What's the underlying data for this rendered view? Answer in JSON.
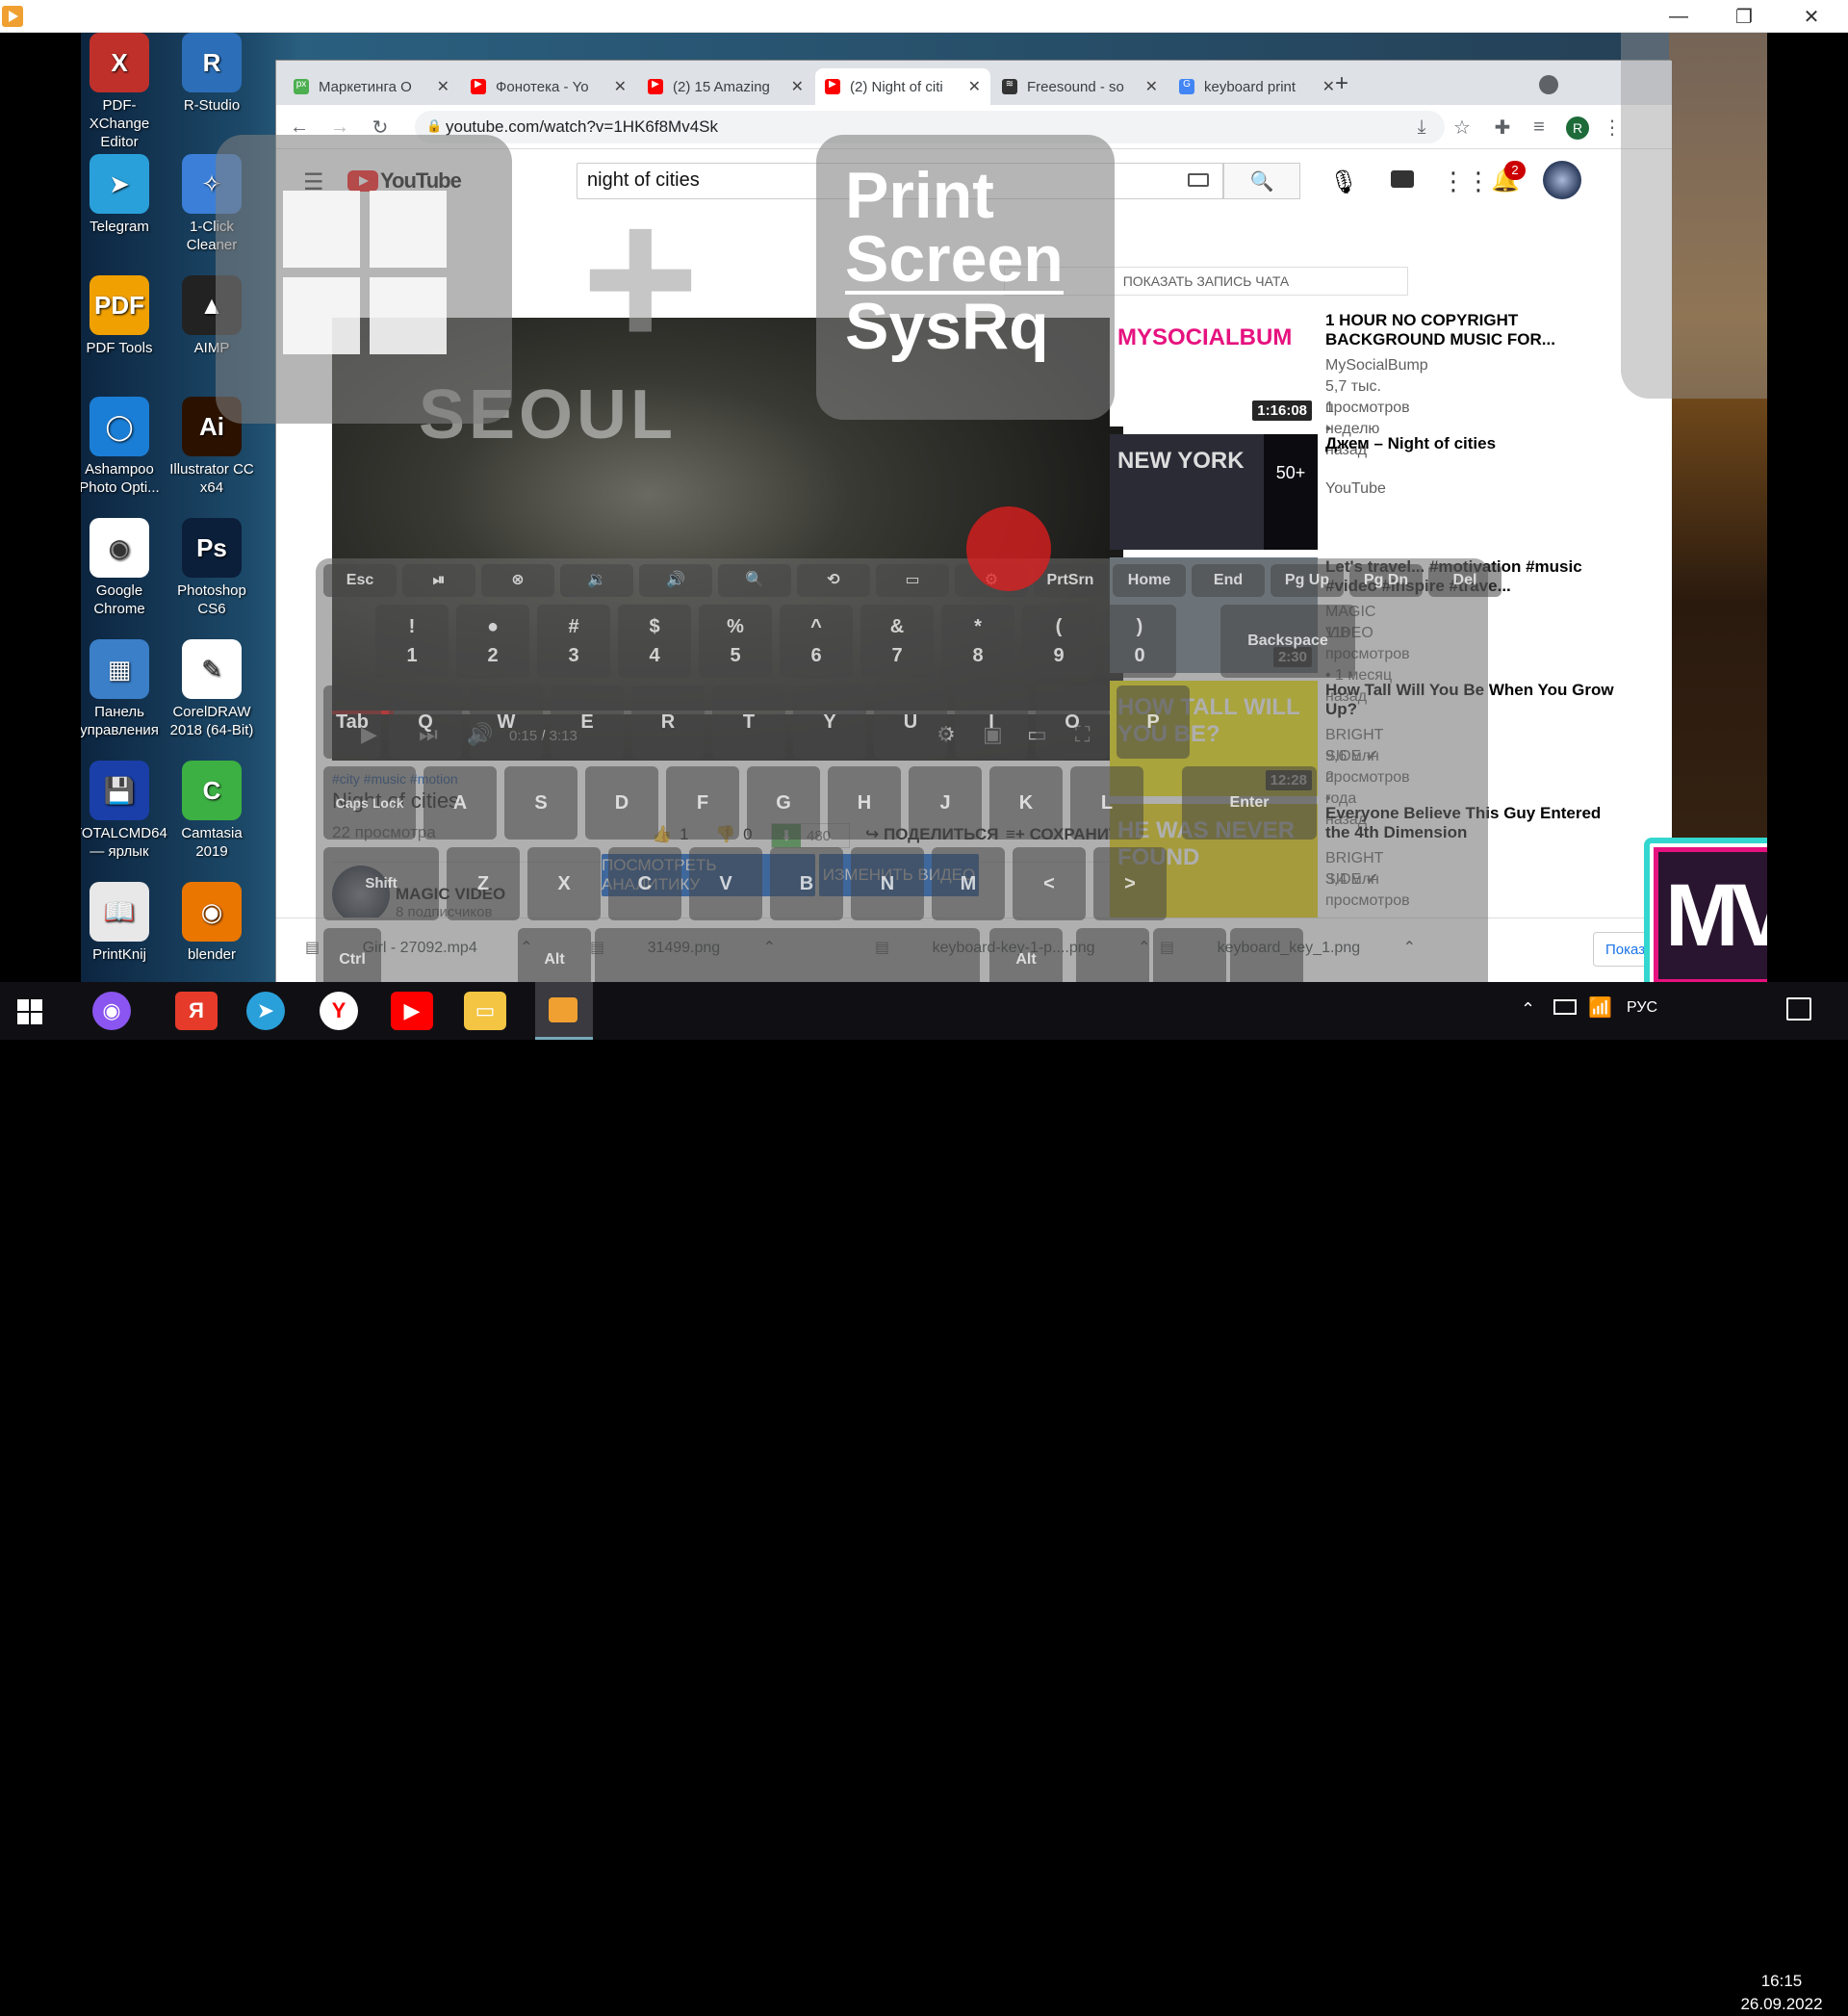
{
  "window": {
    "min": "—",
    "restore": "❐",
    "close": "✕"
  },
  "desktop": {
    "icons": [
      {
        "label": "PDF-XChange Editor",
        "color": "#c0302a",
        "glyph": "X"
      },
      {
        "label": "R-Studio",
        "color": "#2c6fb8",
        "glyph": "R"
      },
      {
        "label": "Telegram",
        "color": "#2aa0da",
        "glyph": "➤"
      },
      {
        "label": "1-Click Cleaner",
        "color": "#3b7fd8",
        "glyph": "✧"
      },
      {
        "label": "PDF Tools",
        "color": "#f0a000",
        "glyph": "PDF"
      },
      {
        "label": "AIMP",
        "color": "#222",
        "glyph": "▲"
      },
      {
        "label": "Ashampoo Photo Opti...",
        "color": "#1b7ed6",
        "glyph": "◯"
      },
      {
        "label": "Illustrator CC x64",
        "color": "#2b1200",
        "glyph": "Ai"
      },
      {
        "label": "Google Chrome",
        "color": "#fff",
        "glyph": "◉"
      },
      {
        "label": "Photoshop CS6",
        "color": "#0b1e3a",
        "glyph": "Ps"
      },
      {
        "label": "Панель управления",
        "color": "#3a7fc8",
        "glyph": "▦"
      },
      {
        "label": "CorelDRAW 2018 (64-Bit)",
        "color": "#fff",
        "glyph": "✎"
      },
      {
        "label": "TOTALCMD64 — ярлык",
        "color": "#1a3fa8",
        "glyph": "💾"
      },
      {
        "label": "Camtasia 2019",
        "color": "#3cb043",
        "glyph": "C"
      },
      {
        "label": "PrintKnij",
        "color": "#e8e8e8",
        "glyph": "📖"
      },
      {
        "label": "blender",
        "color": "#ea7600",
        "glyph": "◉"
      }
    ]
  },
  "browser": {
    "tabs": [
      {
        "title": "Маркетинга О",
        "fav": "#4caf50",
        "glyph": "px"
      },
      {
        "title": "Фонотека - Yo",
        "fav": "#ff0000",
        "glyph": "▶"
      },
      {
        "title": "(2) 15 Amazing",
        "fav": "#ff0000",
        "glyph": "▶"
      },
      {
        "title": "(2) Night of citi",
        "fav": "#ff0000",
        "glyph": "▶"
      },
      {
        "title": "Freesound - so",
        "fav": "#333",
        "glyph": "≋"
      },
      {
        "title": "keyboard print",
        "fav": "#4285f4",
        "glyph": "G"
      }
    ],
    "new_tab": "+",
    "url": "youtube.com/watch?v=1HK6f8Mv4Sk",
    "profile_initial": "R"
  },
  "youtube": {
    "logo": "YouTube",
    "search_value": "night of cities",
    "notif_count": "2",
    "video_overlay_text": "SEOUL",
    "time": "0:15 / 3:13",
    "hashtags": "#city #music #motion",
    "title": "Night of cities",
    "views": "22 просмотра",
    "likes": "1",
    "dislikes": "0",
    "download_count": "480",
    "share": "ПОДЕЛИТЬСЯ",
    "save": "СОХРАНИТЬ",
    "more": "...",
    "channel": "MAGIC VIDEO",
    "subs": "8 подписчиков",
    "analytics_btn": "ПОСМОТРЕТЬ АНАЛИТИКУ",
    "edit_btn": "ИЗМЕНИТЬ ВИДЕО",
    "chat_btn": "ПОКАЗАТЬ ЗАПИСЬ ЧАТА",
    "recs": [
      {
        "title": "1 HOUR NO COPYRIGHT BACKGROUND MUSIC FOR...",
        "channel": "MySocialBump",
        "meta1": "5,7 тыс. просмотров •",
        "meta2": "1 неделю назад",
        "dur": "1:16:08",
        "thumb_text": "MYSOCIALBUM",
        "thumb_bg": "#fff",
        "thumb_fg": "#e6127f"
      },
      {
        "title": "Джем – Night of cities",
        "channel": "YouTube",
        "meta1": "",
        "meta2": "",
        "dur": "",
        "thumb_text": "NEW YORK",
        "thumb_bg": "#2b2b36",
        "thumb_fg": "#ddd",
        "badge": "50+"
      },
      {
        "title": "Let's travel... #motivation #music #video #inspire #trave...",
        "channel": "MAGIC VIDEO",
        "meta1": "118 просмотров • 1 месяц назад",
        "meta2": "",
        "dur": "2:30",
        "thumb_text": "",
        "thumb_bg": "#6b7a86",
        "thumb_fg": "#fff"
      },
      {
        "title": "How Tall Will You Be When You Grow Up?",
        "channel": "BRIGHT SIDE ✔",
        "meta1": "9,6 млн просмотров •",
        "meta2": "2 года назад",
        "dur": "12:28",
        "thumb_text": "HOW TALL WILL YOU BE?",
        "thumb_bg": "#f2e600",
        "thumb_fg": "#fff"
      },
      {
        "title": "Everyone Believe This Guy Entered the 4th Dimension",
        "channel": "BRIGHT SIDE ✔",
        "meta1": "3,4 млн просмотров •",
        "meta2": "",
        "dur": "",
        "thumb_text": "HE WAS NEVER FOUND",
        "thumb_bg": "#e8d200",
        "thumb_fg": "#fff"
      }
    ]
  },
  "downloads": [
    {
      "name": "Girl - 27092.mp4"
    },
    {
      "name": "31499.png"
    },
    {
      "name": "keyboard-key-1-p....png"
    },
    {
      "name": "keyboard_key_1.png"
    }
  ],
  "downloads_show": "Показа",
  "overlay": {
    "print_screen": [
      "Print",
      "Screen",
      "SysRq"
    ],
    "plus": "+"
  },
  "keyboard": {
    "fn_row": [
      "Esc",
      "⏯",
      "⊗",
      "🔉",
      "🔊",
      "🔍",
      "⟲",
      "▭",
      "⚙",
      "PrtSrn",
      "Home",
      "End",
      "Pg Up",
      "Pg Dn",
      "Del"
    ],
    "num_row": [
      [
        "!",
        "1"
      ],
      [
        "●",
        "2"
      ],
      [
        "#",
        "3"
      ],
      [
        "$",
        "4"
      ],
      [
        "%",
        "5"
      ],
      [
        "^",
        "6"
      ],
      [
        "&",
        "7"
      ],
      [
        "*",
        "8"
      ],
      [
        "(",
        "9"
      ],
      [
        ")",
        "0"
      ]
    ],
    "row_q": [
      "Tab",
      "Q",
      "W",
      "E",
      "R",
      "T",
      "Y",
      "U",
      "I",
      "O",
      "P"
    ],
    "row_a": [
      "Caps Lock",
      "A",
      "S",
      "D",
      "F",
      "G",
      "H",
      "J",
      "K",
      "L"
    ],
    "row_z": [
      "Shift",
      "Z",
      "X",
      "C",
      "V",
      "B",
      "N",
      "M",
      "<",
      ">"
    ],
    "row_b": [
      "Ctrl",
      "Alt",
      "Alt"
    ],
    "backspace": "Backspace",
    "enter": "Enter"
  },
  "mv_logo": "MV",
  "taskbar": {
    "lang": "РУС",
    "time": "16:15",
    "date": "26.09.2022"
  }
}
